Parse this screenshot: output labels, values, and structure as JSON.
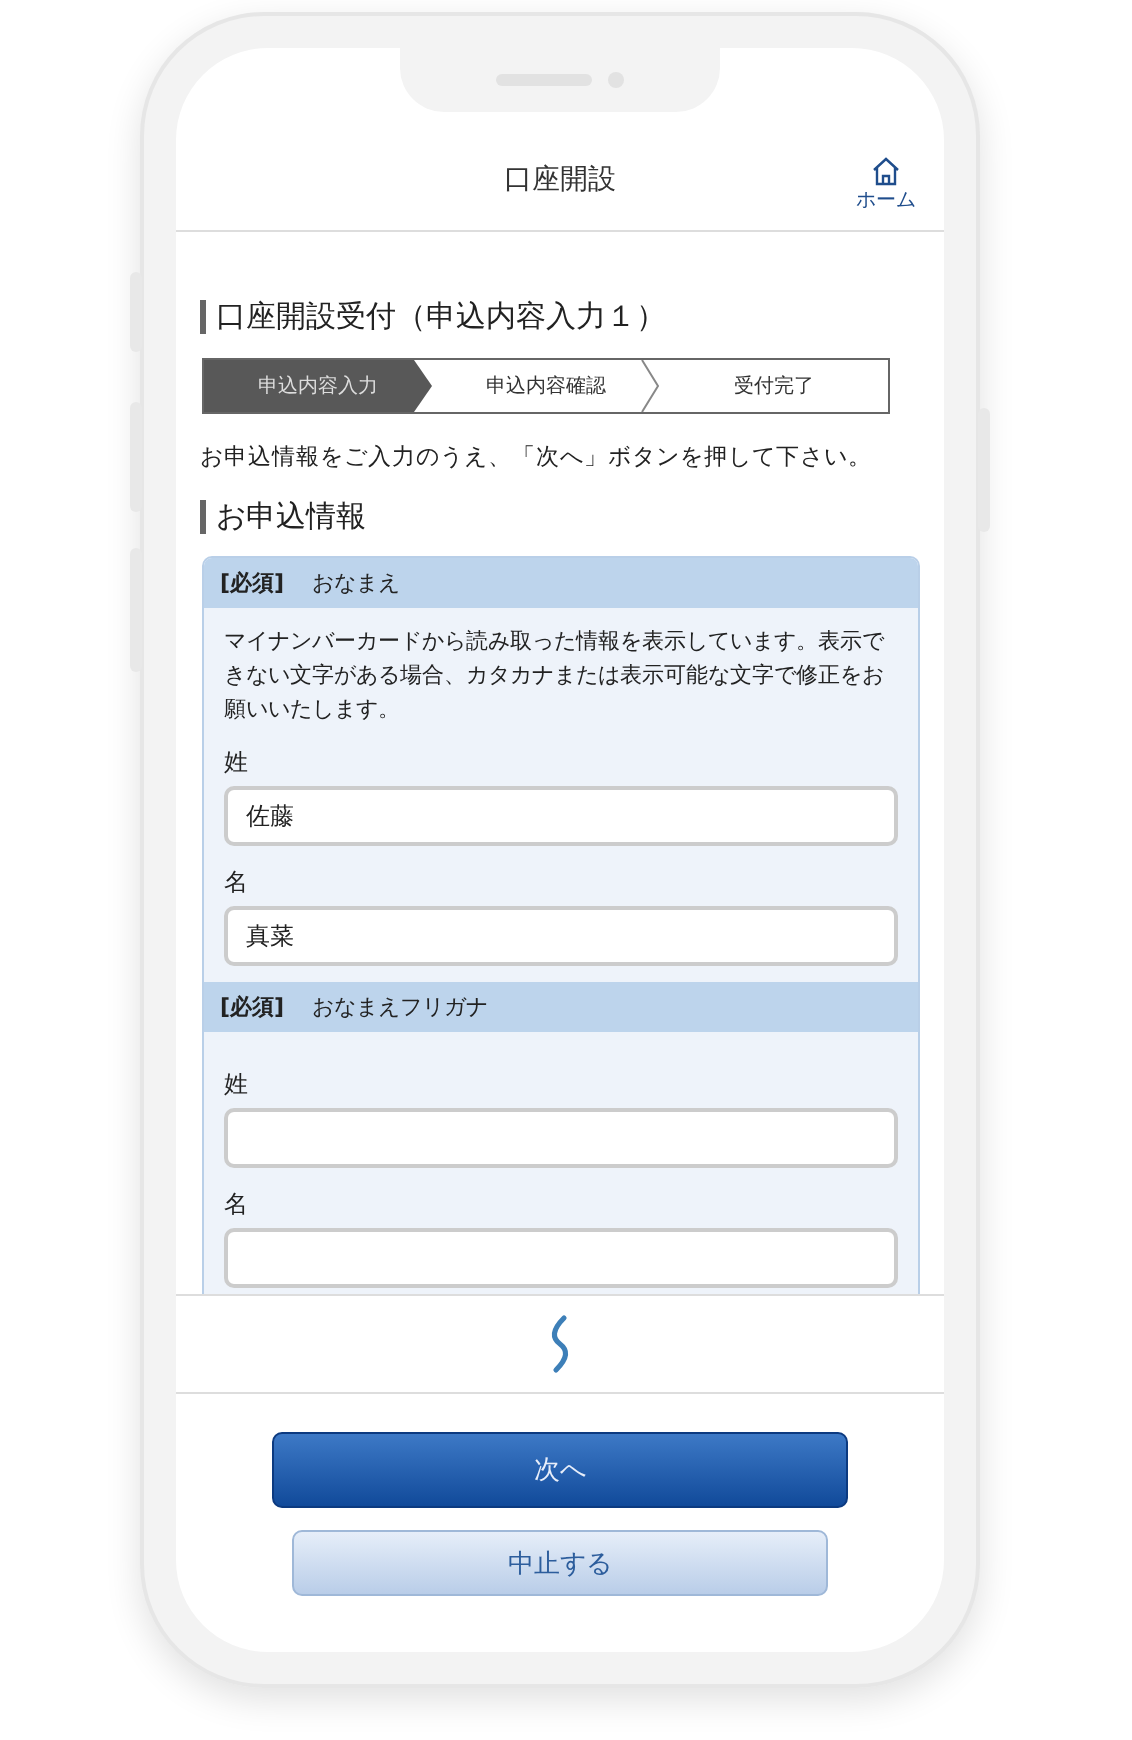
{
  "header": {
    "title": "口座開設",
    "home_link": "ホーム"
  },
  "page_title": "口座開設受付（申込内容入力１）",
  "steps": [
    {
      "label": "申込内容入力",
      "selected": true
    },
    {
      "label": "申込内容確認",
      "selected": false
    },
    {
      "label": "受付完了",
      "selected": false
    }
  ],
  "instruction": "お申込情報をご入力のうえ、「次へ」ボタンを押して下さい。",
  "section_title": "お申込情報",
  "field_groups": [
    {
      "required_tag": "[必須]",
      "title": "おなまえ",
      "note": "マイナンバーカードから読み取った情報を表示しています。表示できない文字がある場合、カタカナまたは表示可能な文字で修正をお願いいたします。",
      "fields": [
        {
          "label": "姓",
          "value": "佐藤"
        },
        {
          "label": "名",
          "value": "真菜"
        }
      ]
    },
    {
      "required_tag": "[必須]",
      "title": "おなまえフリガナ",
      "fields": [
        {
          "label": "姓"
        },
        {
          "label": "名"
        }
      ]
    }
  ],
  "buttons": [
    {
      "label": "次へ",
      "kind": "primary"
    },
    {
      "label": "中止する",
      "kind": "secondary"
    }
  ]
}
